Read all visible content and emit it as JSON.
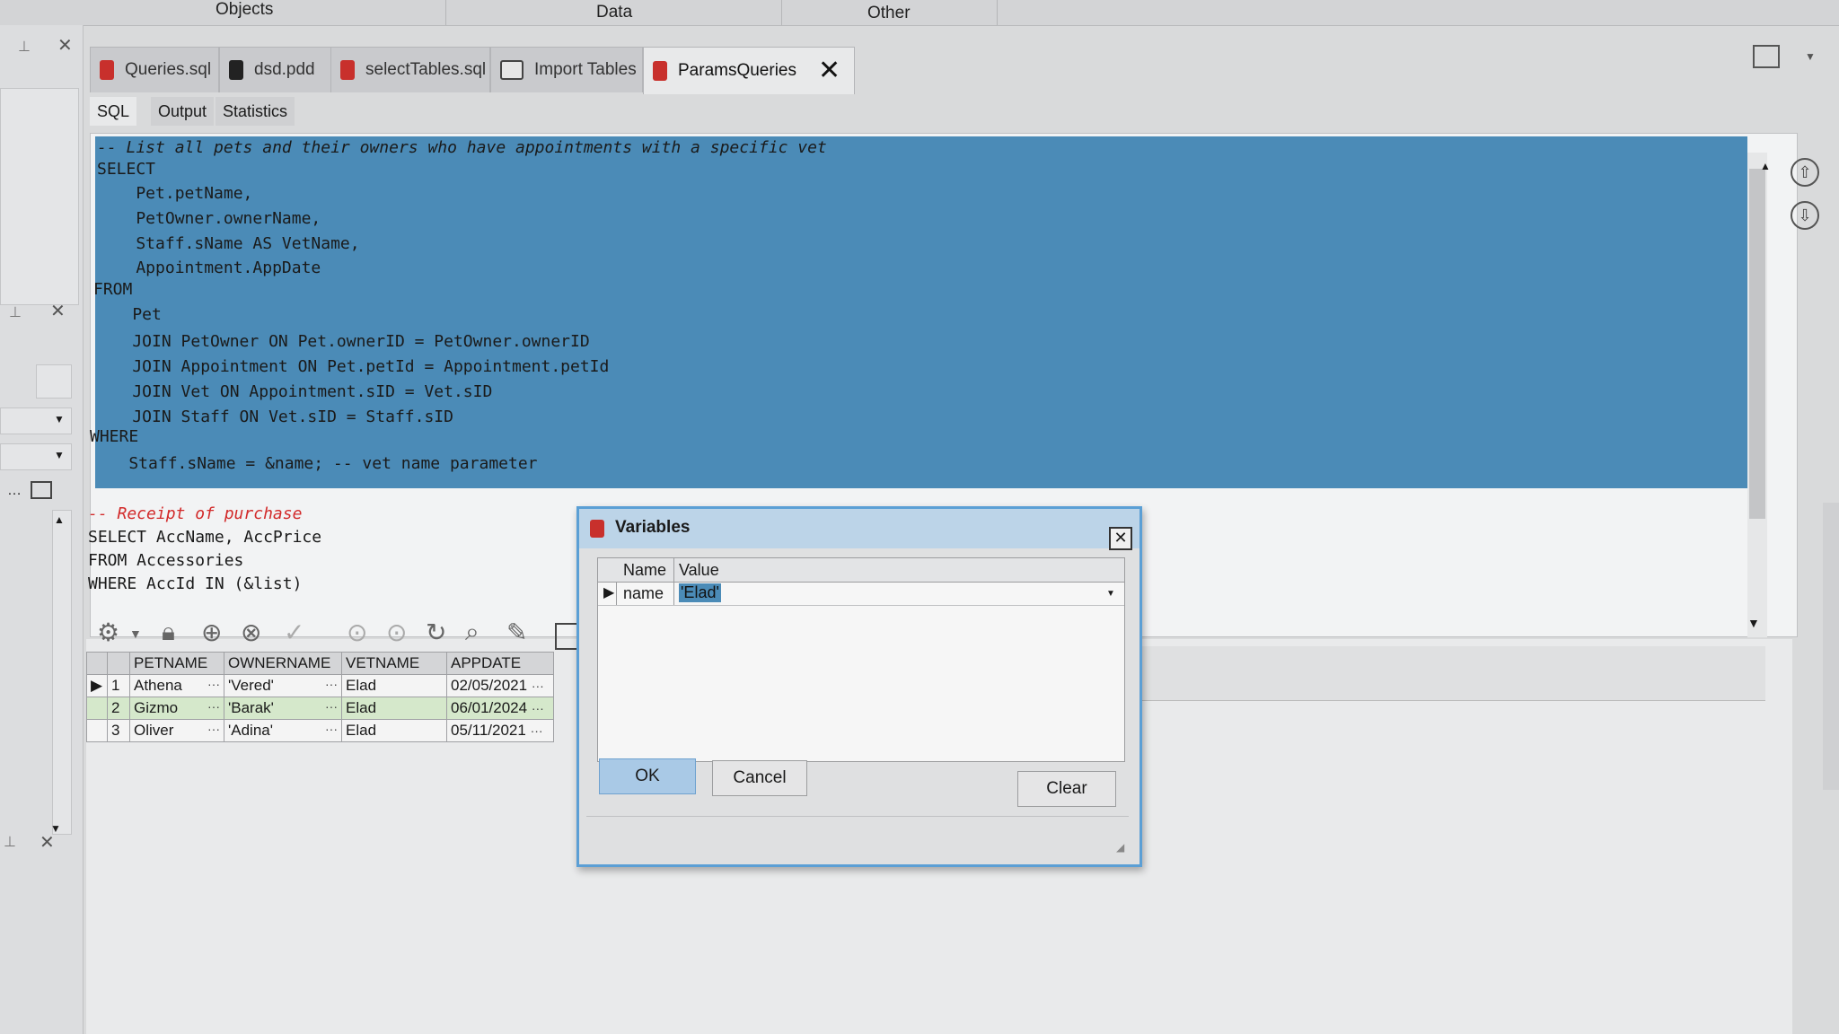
{
  "menu": {
    "objects": "Objects",
    "data": "Data",
    "other": "Other"
  },
  "tabs": [
    {
      "label": "Queries.sql"
    },
    {
      "label": "dsd.pdd"
    },
    {
      "label": "selectTables.sql"
    },
    {
      "label": "Import Tables"
    },
    {
      "label": "ParamsQueries"
    }
  ],
  "subtabs": {
    "sql": "SQL",
    "output": "Output",
    "statistics": "Statistics"
  },
  "editor": {
    "lines": [
      "-- List all pets and their owners who have appointments with a specific vet",
      "SELECT",
      "    Pet.petName,",
      "    PetOwner.ownerName,",
      "    Staff.sName AS VetName,",
      "    Appointment.AppDate",
      "FROM",
      "    Pet",
      "    JOIN PetOwner ON Pet.ownerID = PetOwner.ownerID",
      "    JOIN Appointment ON Pet.petId = Appointment.petId",
      "    JOIN Vet ON Appointment.sID = Vet.sID",
      "    JOIN Staff ON Vet.sID = Staff.sID",
      "WHERE",
      "    Staff.sName = &name; -- vet name parameter",
      "-- Receipt of purchase",
      "SELECT AccName, AccPrice",
      "FROM Accessories",
      "WHERE AccId IN (&list)"
    ]
  },
  "grid": {
    "columns": [
      "PETNAME",
      "OWNERNAME",
      "VETNAME",
      "APPDATE"
    ],
    "rows": [
      {
        "n": "1",
        "petname": "Athena",
        "ownername": "'Vered'",
        "vetname": "Elad",
        "appdate": "02/05/2021"
      },
      {
        "n": "2",
        "petname": "Gizmo",
        "ownername": "'Barak'",
        "vetname": "Elad",
        "appdate": "06/01/2024"
      },
      {
        "n": "3",
        "petname": "Oliver",
        "ownername": "'Adina'",
        "vetname": "Elad",
        "appdate": "05/11/2021"
      }
    ],
    "ellipsis": "···"
  },
  "dialog": {
    "title": "Variables",
    "col_name": "Name",
    "col_value": "Value",
    "var_name": "name",
    "var_value": "'Elad'",
    "ok": "OK",
    "cancel": "Cancel",
    "clear": "Clear"
  },
  "icons": {
    "pin": "pin-icon",
    "close": "close-icon",
    "sql_file": "sql-file-icon",
    "import": "table-icon",
    "lock": "lock-icon",
    "add": "add-icon",
    "delete": "delete-icon",
    "refresh": "refresh-icon"
  },
  "colors": {
    "selection": "#4b8bb7",
    "dialog_border": "#5b9fd5",
    "row_highlight": "#d5e8cb",
    "sql_icon": "#c8302c"
  }
}
